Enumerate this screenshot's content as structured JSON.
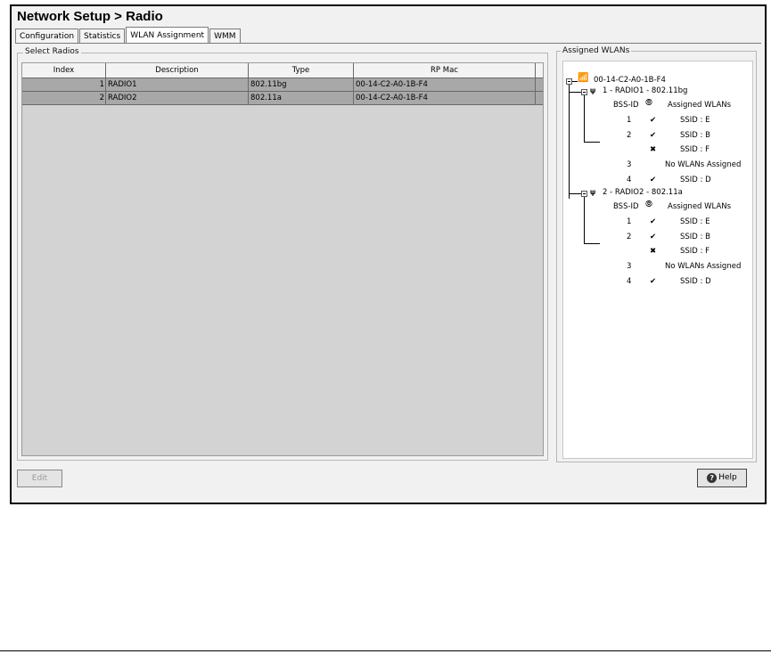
{
  "window": {
    "title": "Network Setup > Radio"
  },
  "tabs": [
    {
      "label": "Configuration"
    },
    {
      "label": "Statistics"
    },
    {
      "label": "WLAN Assignment"
    },
    {
      "label": "WMM"
    }
  ],
  "select_radios": {
    "label": "Select Radios",
    "columns": [
      "Index",
      "Description",
      "Type",
      "RP Mac"
    ],
    "rows": [
      {
        "index": "1",
        "description": "RADIO1",
        "type": "802.11bg",
        "mac": "00-14-C2-A0-1B-F4"
      },
      {
        "index": "2",
        "description": "RADIO2",
        "type": "802.11a",
        "mac": "00-14-C2-A0-1B-F4"
      }
    ]
  },
  "assigned_wlans": {
    "label": "Assigned WLANs",
    "root": "00-14-C2-A0-1B-F4",
    "radios": [
      {
        "label": "1 - RADIO1 - 802.11bg",
        "header_bss": "BSS-ID",
        "header_assigned": "Assigned WLANs",
        "entries": [
          {
            "bss": "1",
            "mark": "✔",
            "ssid": "SSID : E"
          },
          {
            "bss": "2",
            "mark": "✔",
            "ssid": "SSID : B"
          },
          {
            "bss": "",
            "mark": "✖",
            "ssid": "SSID : F"
          },
          {
            "bss": "3",
            "mark": "",
            "ssid": "No WLANs Assigned"
          },
          {
            "bss": "4",
            "mark": "✔",
            "ssid": "SSID : D"
          }
        ]
      },
      {
        "label": "2 - RADIO2 - 802.11a",
        "header_bss": "BSS-ID",
        "header_assigned": "Assigned WLANs",
        "entries": [
          {
            "bss": "1",
            "mark": "✔",
            "ssid": "SSID : E"
          },
          {
            "bss": "2",
            "mark": "✔",
            "ssid": "SSID : B"
          },
          {
            "bss": "",
            "mark": "✖",
            "ssid": "SSID : F"
          },
          {
            "bss": "3",
            "mark": "",
            "ssid": "No WLANs Assigned"
          },
          {
            "bss": "4",
            "mark": "✔",
            "ssid": "SSID : D"
          }
        ]
      }
    ]
  },
  "buttons": {
    "edit": "Edit",
    "help": "Help",
    "help_glyph": "?"
  }
}
